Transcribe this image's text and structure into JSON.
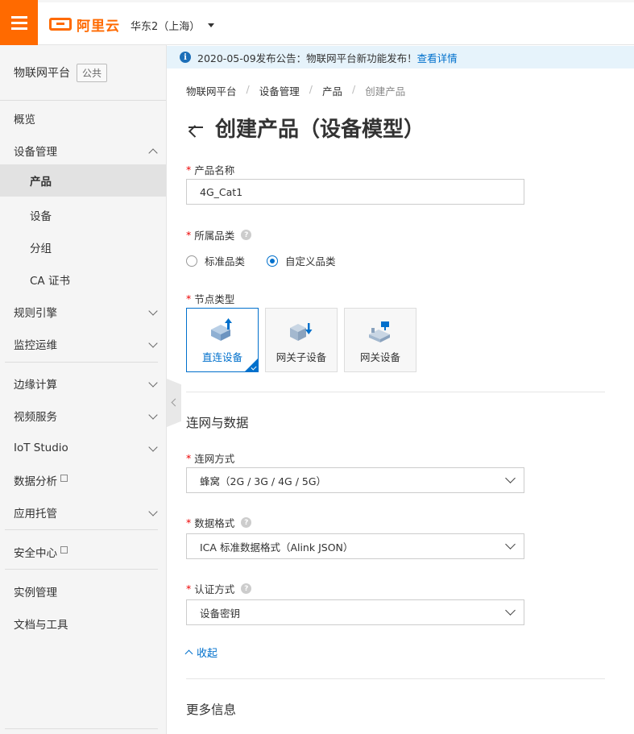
{
  "header": {
    "logo_text": "阿里云",
    "region": "华东2（上海）"
  },
  "sidebar": {
    "title": "物联网平台",
    "tag": "公共",
    "items": [
      {
        "label": "概览"
      },
      {
        "label": "设备管理"
      },
      {
        "label": "产品"
      },
      {
        "label": "设备"
      },
      {
        "label": "分组"
      },
      {
        "label": "CA 证书"
      },
      {
        "label": "规则引擎"
      },
      {
        "label": "监控运维"
      },
      {
        "label": "边缘计算"
      },
      {
        "label": "视频服务"
      },
      {
        "label": "IoT Studio"
      },
      {
        "label": "数据分析"
      },
      {
        "label": "应用托管"
      },
      {
        "label": "安全中心"
      },
      {
        "label": "实例管理"
      },
      {
        "label": "文档与工具"
      }
    ]
  },
  "notice": {
    "text": "2020-05-09发布公告：物联网平台新功能发布！",
    "link": "查看详情"
  },
  "breadcrumb": [
    "物联网平台",
    "设备管理",
    "产品",
    "创建产品"
  ],
  "page_title": "创建产品（设备模型）",
  "form": {
    "product_name": {
      "label": "产品名称",
      "value": "4G_Cat1"
    },
    "category": {
      "label": "所属品类",
      "options": [
        "标准品类",
        "自定义品类"
      ],
      "selected": "自定义品类"
    },
    "node_type": {
      "label": "节点类型",
      "options": [
        "直连设备",
        "网关子设备",
        "网关设备"
      ],
      "selected": "直连设备"
    },
    "section_network": "连网与数据",
    "network_mode": {
      "label": "连网方式",
      "value": "蜂窝（2G / 3G / 4G / 5G）"
    },
    "data_format": {
      "label": "数据格式",
      "value": "ICA 标准数据格式（Alink JSON）"
    },
    "auth_mode": {
      "label": "认证方式",
      "value": "设备密钥"
    },
    "collapse_label": "收起",
    "section_more": "更多信息"
  },
  "colors": {
    "brand": "#ff6a00",
    "accent": "#0070cc",
    "required": "#e00000"
  }
}
